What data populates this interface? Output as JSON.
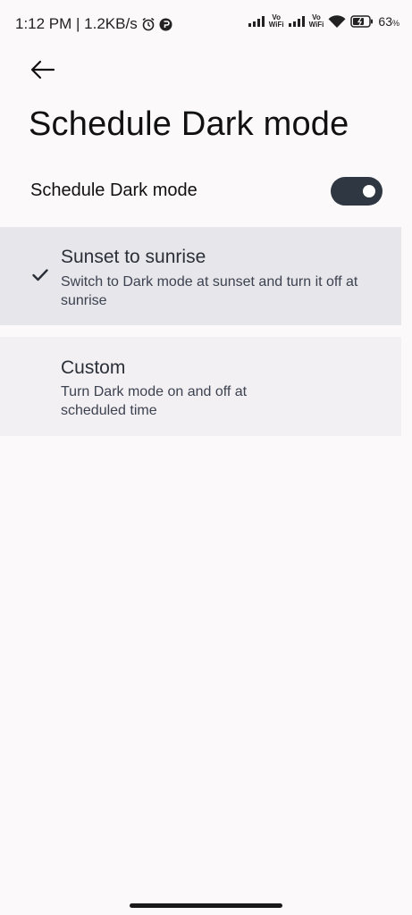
{
  "status_bar": {
    "time_speed": "1:12 PM | 1.2KB/s",
    "vo_wifi_top": "Vo",
    "vo_wifi_bottom": "WiFi",
    "battery_percent": "63",
    "battery_unit": "%"
  },
  "header": {
    "title": "Schedule Dark mode"
  },
  "toggle": {
    "label": "Schedule Dark mode",
    "state": "on"
  },
  "options": [
    {
      "title": "Sunset to sunrise",
      "description": "Switch to Dark mode at sunset and turn it off at sunrise",
      "selected": true
    },
    {
      "title": "Custom",
      "description": "Turn Dark mode on and off at scheduled time",
      "selected": false
    }
  ],
  "colors": {
    "background": "#fbf9fa",
    "toggle_on": "#2f3742",
    "selected_row": "#e7e6ea",
    "row": "#f3f0f3"
  }
}
